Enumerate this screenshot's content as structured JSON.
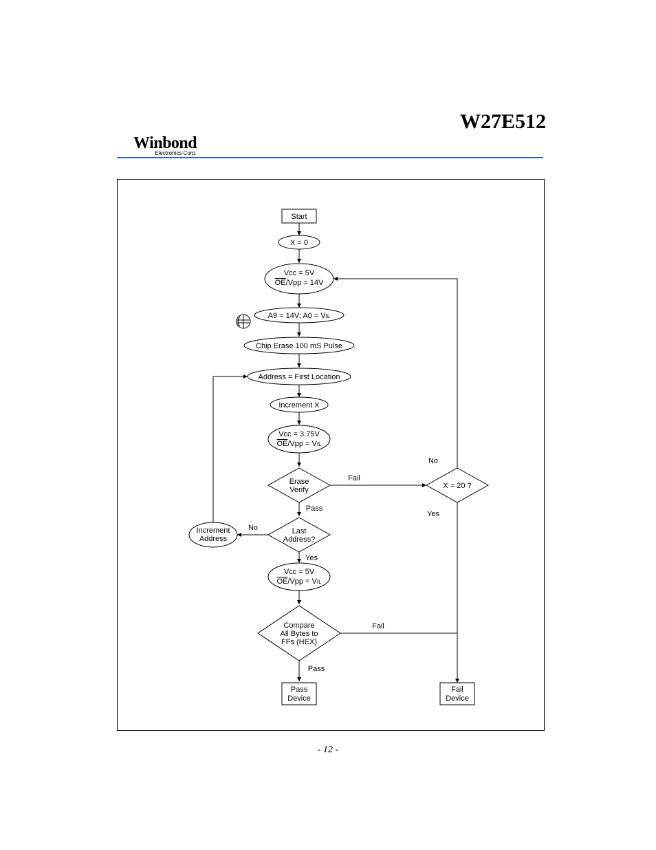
{
  "header": {
    "part_number": "W27E512",
    "logo_text": "Winbond",
    "logo_subtitle": "Electronics Corp."
  },
  "footer": {
    "page_number": "- 12 -"
  },
  "chart_data": {
    "type": "flowchart",
    "nodes": [
      {
        "id": "start",
        "shape": "rect",
        "label": "Start"
      },
      {
        "id": "x0",
        "shape": "ellipse",
        "label": "X = 0"
      },
      {
        "id": "vcc5_oe14",
        "shape": "ellipse",
        "lines": [
          "Vcc = 5V",
          "OE/Vpp = 14V"
        ],
        "overline_on": "OE"
      },
      {
        "id": "a9",
        "shape": "ellipse",
        "label": "A9 = 14V; A0 = VIL"
      },
      {
        "id": "erase_pulse",
        "shape": "ellipse",
        "label": "Chip Erase 100 mS Pulse"
      },
      {
        "id": "addr_first",
        "shape": "ellipse",
        "label": "Address = First Location"
      },
      {
        "id": "incx",
        "shape": "ellipse",
        "label": "Increment X"
      },
      {
        "id": "vcc375",
        "shape": "ellipse",
        "lines": [
          "Vcc = 3.75V",
          "OE/Vpp = VIL"
        ],
        "overline_on": "OE"
      },
      {
        "id": "erase_verify",
        "shape": "diamond",
        "lines": [
          "Erase",
          "Verify"
        ]
      },
      {
        "id": "last_addr",
        "shape": "diamond",
        "lines": [
          "Last",
          "Address?"
        ]
      },
      {
        "id": "inc_addr",
        "shape": "ellipse",
        "lines": [
          "Increment",
          "Address"
        ]
      },
      {
        "id": "vcc5_vil",
        "shape": "ellipse",
        "lines": [
          "Vcc = 5V",
          "OE/Vpp = VIL"
        ],
        "overline_on": "OE"
      },
      {
        "id": "compare",
        "shape": "diamond",
        "lines": [
          "Compare",
          "All Bytes to",
          "FFs (HEX)"
        ]
      },
      {
        "id": "x20",
        "shape": "diamond",
        "label": "X = 20 ?"
      },
      {
        "id": "pass_dev",
        "shape": "rect",
        "lines": [
          "Pass",
          "Device"
        ]
      },
      {
        "id": "fail_dev",
        "shape": "rect",
        "lines": [
          "Fail",
          "Device"
        ]
      }
    ],
    "edges": [
      {
        "from": "start",
        "to": "x0"
      },
      {
        "from": "x0",
        "to": "vcc5_oe14"
      },
      {
        "from": "vcc5_oe14",
        "to": "a9"
      },
      {
        "from": "a9",
        "to": "erase_pulse"
      },
      {
        "from": "erase_pulse",
        "to": "addr_first"
      },
      {
        "from": "addr_first",
        "to": "incx"
      },
      {
        "from": "incx",
        "to": "vcc375"
      },
      {
        "from": "vcc375",
        "to": "erase_verify"
      },
      {
        "from": "erase_verify",
        "to": "last_addr",
        "label": "Pass"
      },
      {
        "from": "erase_verify",
        "to": "x20",
        "label": "Fail"
      },
      {
        "from": "x20",
        "to": "vcc5_oe14",
        "label": "No"
      },
      {
        "from": "x20",
        "to": "fail_dev",
        "label": "Yes"
      },
      {
        "from": "last_addr",
        "to": "inc_addr",
        "label": "No"
      },
      {
        "from": "inc_addr",
        "to": "addr_first"
      },
      {
        "from": "last_addr",
        "to": "vcc5_vil",
        "label": "Yes"
      },
      {
        "from": "vcc5_vil",
        "to": "compare"
      },
      {
        "from": "compare",
        "to": "pass_dev",
        "label": "Pass"
      },
      {
        "from": "compare",
        "to": "fail_dev",
        "label": "Fail"
      }
    ]
  },
  "labels": {
    "start": "Start",
    "x0": "X = 0",
    "vcc5_a": "Vcc = 5V",
    "oe14": "/Vpp = 14V",
    "oe_txt": "OE",
    "a9": "A9 = 14V; A0 = V",
    "il": "IL",
    "erase_pulse": "Chip Erase 100 mS Pulse",
    "addr_first": "Address = First Location",
    "incx": "Increment X",
    "vcc375_a": "Vcc = 3.75V",
    "oevil": "/Vpp = V",
    "erase": "Erase",
    "verify": "Verify",
    "last": "Last",
    "address_q": "Address?",
    "inc": "Increment",
    "addr": "Address",
    "vcc5_b": "Vcc = 5V",
    "compare_a": "Compare",
    "compare_b": "All Bytes to",
    "compare_c": "FFs (HEX)",
    "x20": "X = 20 ?",
    "pass": "Pass",
    "fail": "Fail",
    "yes": "Yes",
    "no": "No",
    "pass_dev_a": "Pass",
    "pass_dev_b": "Device",
    "fail_dev_a": "Fail",
    "fail_dev_b": "Device"
  }
}
